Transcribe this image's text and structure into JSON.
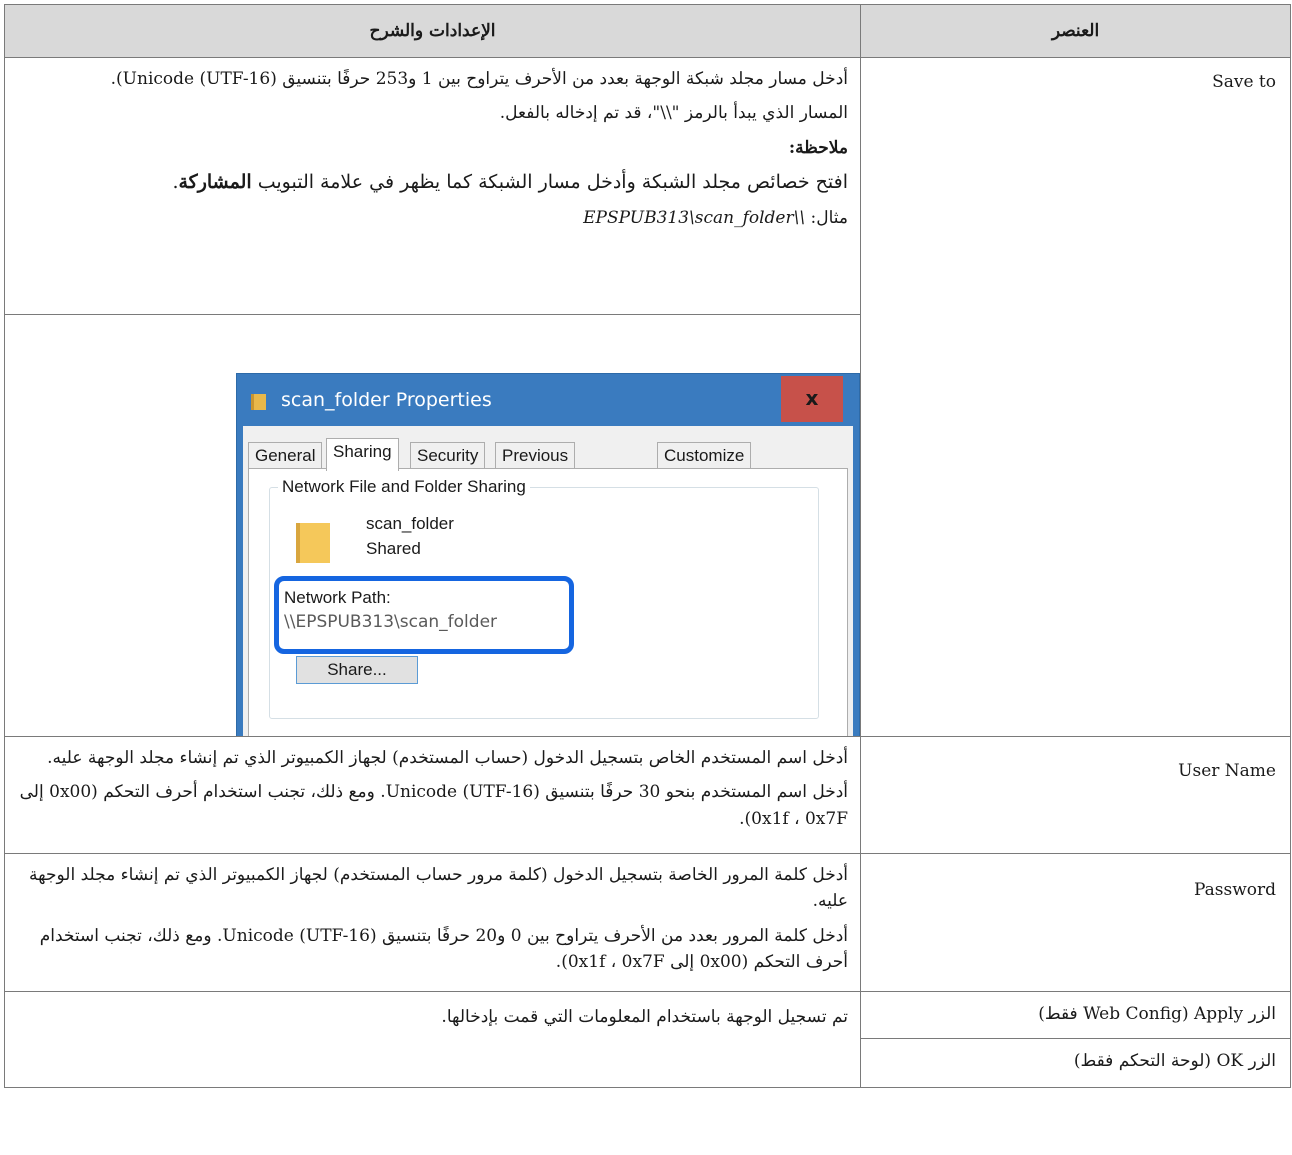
{
  "headers": {
    "item": "العنصر",
    "description": "الإعدادات والشرح"
  },
  "rows": {
    "save_to": {
      "item": "Save to",
      "desc1": "أدخل مسار مجلد شبكة الوجهة بعدد من الأحرف يتراوح بين 1 و253 حرفًا بتنسيق Unicode (UTF-16)).",
      "desc2": "المسار الذي يبدأ بالرمز \"\\\\\"، قد تم إدخاله بالفعل.",
      "note_title": "ملاحظة:",
      "note_before": "افتح خصائص مجلد الشبكة وأدخل مسار الشبكة كما يظهر في علامة التبويب ",
      "note_bold": "المشاركة",
      "note_after": ".",
      "example_label": "مثال: ",
      "example_value": "\\\\EPSPUB313\\scan_folder"
    },
    "user_name": {
      "item": "User Name",
      "desc1": "أدخل اسم المستخدم الخاص بتسجيل الدخول (حساب المستخدم) لجهاز الكمبيوتر الذي تم إنشاء مجلد الوجهة عليه.",
      "desc2": "أدخل اسم المستخدم بنحو 30 حرفًا بتنسيق Unicode (UTF-16). ومع ذلك، تجنب استخدام أحرف التحكم (0x00 إلى 0x1f ، 0x7F)."
    },
    "password": {
      "item": "Password",
      "desc1": "أدخل كلمة المرور الخاصة بتسجيل الدخول (كلمة مرور حساب المستخدم) لجهاز الكمبيوتر الذي تم إنشاء مجلد الوجهة عليه.",
      "desc2": "أدخل كلمة المرور بعدد من الأحرف يتراوح بين 0 و20 حرفًا بتنسيق Unicode (UTF-16). ومع ذلك، تجنب استخدام أحرف التحكم (0x00 إلى 0x1f ، 0x7F)."
    },
    "apply": {
      "item": "الزر Apply (Web Config فقط)",
      "desc": "تم تسجيل الوجهة باستخدام المعلومات التي قمت بإدخالها."
    },
    "ok": {
      "item": "الزر OK (لوحة التحكم فقط)"
    }
  },
  "dialog": {
    "title": "scan_folder Properties",
    "close_label": "x",
    "tabs": [
      "General",
      "Sharing",
      "Security",
      "Previous Versions",
      "Customize"
    ],
    "active_tab": "Sharing",
    "group_title": "Network File and Folder Sharing",
    "folder_name": "scan_folder",
    "folder_state": "Shared",
    "network_path_label": "Network Path:",
    "network_path_value": "\\\\EPSPUB313\\scan_folder",
    "share_button": "Share...",
    "highlight_color": "#1565e0"
  }
}
